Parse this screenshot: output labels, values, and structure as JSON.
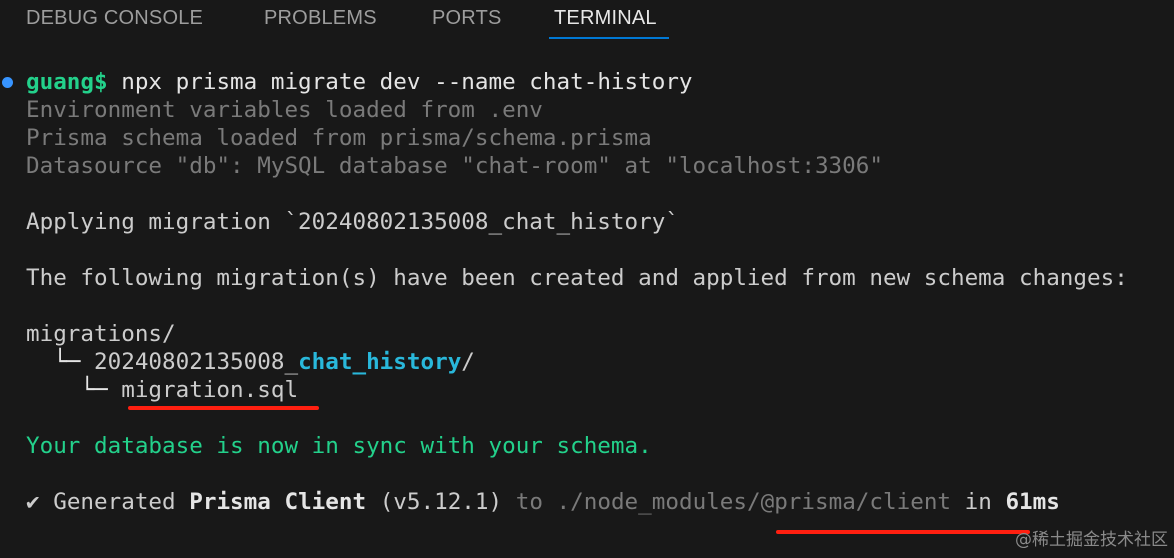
{
  "tabs": [
    {
      "label": "DEBUG CONSOLE",
      "active": false
    },
    {
      "label": "PROBLEMS",
      "active": false
    },
    {
      "label": "PORTS",
      "active": false
    },
    {
      "label": "TERMINAL",
      "active": true
    }
  ],
  "terminal": {
    "prompt_user": "guang$",
    "command": " npx prisma migrate dev --name chat-history",
    "env_line": "Environment variables loaded from .env",
    "schema_line": "Prisma schema loaded from prisma/schema.prisma",
    "datasource_line": "Datasource \"db\": MySQL database \"chat-room\" at \"localhost:3306\"",
    "applying_line": "Applying migration `20240802135008_chat_history`",
    "created_line": "The following migration(s) have been created and applied from new schema changes:",
    "migrations_dir": "migrations/",
    "tree_branch_1": "  └─ ",
    "migration_folder_prefix": "20240802135008_",
    "migration_folder_name": "chat_history",
    "migration_folder_slash": "/",
    "tree_branch_2": "    └─ ",
    "migration_file": "migration.sql",
    "sync_line": "Your database is now in sync with your schema.",
    "generated": {
      "check": "✔ ",
      "text_1": "Generated ",
      "product": "Prisma Client",
      "version": " (v5.12.1)",
      "to_word": " to ",
      "path": "./node_modules/@prisma/client",
      "in_text": " in ",
      "duration": "61ms"
    }
  },
  "watermark": "@稀土掘金技术社区",
  "colors": {
    "background": "#181818",
    "prompt_green": "#23d18b",
    "folder_blue": "#29b8db",
    "annotation_red": "#ff1f10",
    "tab_accent": "#0078d4"
  }
}
